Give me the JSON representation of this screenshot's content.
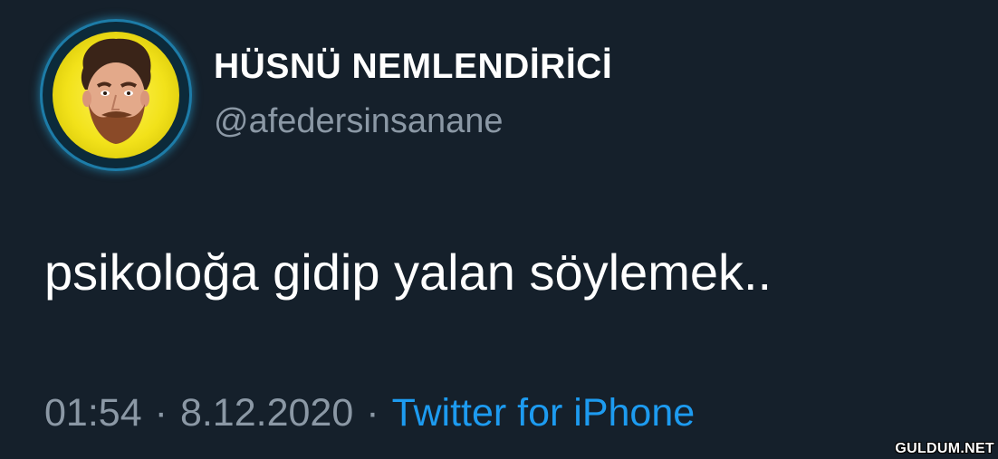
{
  "tweet": {
    "author": {
      "display_name": "HÜSNÜ NEMLENDİRİCİ",
      "handle": "@afedersinsanane"
    },
    "text": "psikoloğa gidip yalan söylemek..",
    "time": "01:54",
    "date": "8.12.2020",
    "separator": "·",
    "source": "Twitter for iPhone"
  },
  "watermark": "GULDUM.NET",
  "colors": {
    "background": "#15202b",
    "text": "#ffffff",
    "muted": "#8b98a5",
    "link": "#1d9bf0",
    "avatar_bg": "#f2e21a",
    "avatar_ring": "#1d7ca8"
  }
}
